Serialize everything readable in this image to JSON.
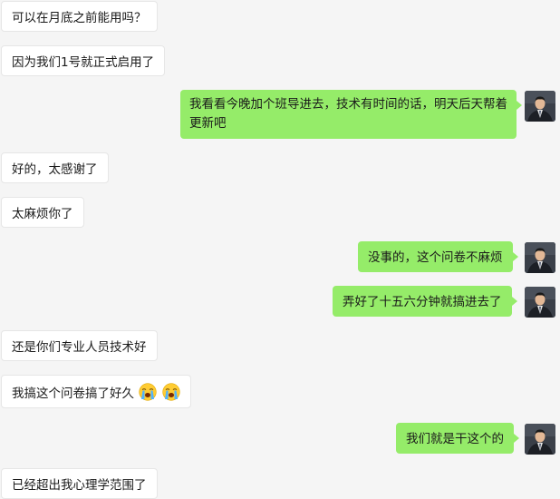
{
  "messages": [
    {
      "side": "in",
      "text": "可以在月底之前能用吗？"
    },
    {
      "side": "in",
      "text": "因为我们1号就正式启用了"
    },
    {
      "side": "out",
      "text": "我看看今晚加个班导进去，技术有时间的话，明天后天帮着更新吧"
    },
    {
      "side": "in",
      "text": "好的，太感谢了"
    },
    {
      "side": "in",
      "text": "太麻烦你了"
    },
    {
      "side": "out",
      "text": "没事的，这个问卷不麻烦"
    },
    {
      "side": "out",
      "text": "弄好了十五六分钟就搞进去了"
    },
    {
      "side": "in",
      "text": "还是你们专业人员技术好"
    },
    {
      "side": "in",
      "text": "我搞这个问卷搞了好久",
      "emojis": [
        "crying-face-icon",
        "crying-face-icon"
      ]
    },
    {
      "side": "out",
      "text": "我们就是干这个的"
    },
    {
      "side": "in",
      "text": "已经超出我心理学范围了"
    }
  ],
  "colors": {
    "background": "#f5f5f5",
    "incoming_bubble": "#ffffff",
    "outgoing_bubble": "#95ec69"
  }
}
